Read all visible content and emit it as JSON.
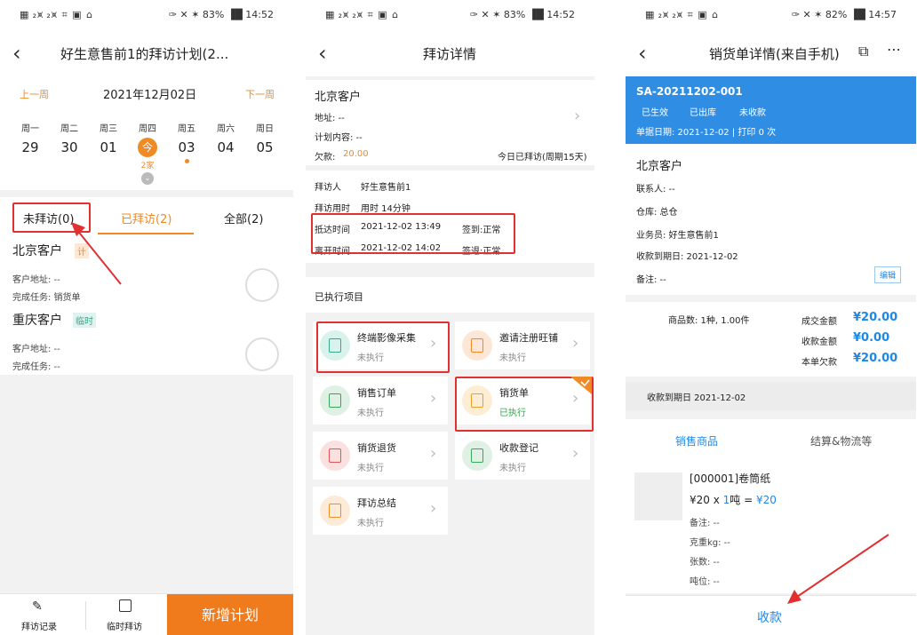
{
  "status": {
    "left_text": "▦ ₂⩙ ₂⩙ ⌗ ▣ ⌂",
    "right_text_1": "✑ ✕ ✶ 83% ▐█ 14:52",
    "right_text_2": "✑ ✕ ✶ 83% ▐█ 14:52",
    "right_text_3": "✑ ✕ ✶ 82% ▐█ 14:57"
  },
  "panel1": {
    "title": "好生意售前1的拜访计划(2...",
    "prev_week": "上一周",
    "date": "2021年12月02日",
    "next_week": "下一周",
    "week_days": [
      "周一",
      "周二",
      "周三",
      "周四",
      "周五",
      "周六",
      "周日"
    ],
    "week_dates": [
      "29",
      "30",
      "01",
      "今",
      "03",
      "04",
      "05"
    ],
    "today_count": "2家",
    "tabs": [
      "未拜访(0)",
      "已拜访(2)",
      "全部(2)"
    ],
    "clients": [
      {
        "name": "北京客户",
        "tag": "计",
        "address_label": "客户地址: --",
        "task_label": "完成任务: 销货单"
      },
      {
        "name": "重庆客户",
        "tag": "临时",
        "address_label": "客户地址: --",
        "task_label": "完成任务: --"
      }
    ],
    "bottom": {
      "record": "拜访记录",
      "temp": "临时拜访",
      "add": "新增计划"
    }
  },
  "panel2": {
    "title": "拜访详情",
    "client": "北京客户",
    "address": "地址: --",
    "plan": "计划内容: --",
    "debt_label": "欠款:",
    "debt_value": "20.00",
    "visited_today": "今日已拜访(周期15天)",
    "rows": [
      {
        "label": "拜访人",
        "value": "好生意售前1",
        "extra": ""
      },
      {
        "label": "拜访用时",
        "value": "用时 14分钟",
        "extra": ""
      },
      {
        "label": "抵达时间",
        "value": "2021-12-02 13:49",
        "extra": "签到:正常"
      },
      {
        "label": "离开时间",
        "value": "2021-12-02 14:02",
        "extra": "签退:正常"
      }
    ],
    "executed_title": "已执行项目",
    "items": [
      {
        "name": "终端影像采集",
        "status": "未执行"
      },
      {
        "name": "邀请注册旺铺",
        "status": "未执行"
      },
      {
        "name": "销售订单",
        "status": "未执行"
      },
      {
        "name": "销货单",
        "status": "已执行"
      },
      {
        "name": "销货退货",
        "status": "未执行"
      },
      {
        "name": "收款登记",
        "status": "未执行"
      },
      {
        "name": "拜访总结",
        "status": "未执行"
      }
    ]
  },
  "panel3": {
    "title": "销货单详情(来自手机)",
    "order_no": "SA-20211202-001",
    "badges": [
      "已生效",
      "已出库",
      "未收款"
    ],
    "order_date": "单据日期: 2021-12-02 | 打印 0 次",
    "client": "北京客户",
    "contact": "联系人: --",
    "warehouse": "仓库: 总仓",
    "salesman": "业务员: 好生意售前1",
    "due_date": "收款到期日: 2021-12-02",
    "remark": "备注: --",
    "edit": "编辑",
    "goods_count": "商品数: 1种, 1.00件",
    "amounts": [
      {
        "label": "成交金额",
        "value": "¥20.00"
      },
      {
        "label": "收款金额",
        "value": "¥0.00"
      },
      {
        "label": "本单欠款",
        "value": "¥20.00"
      }
    ],
    "due_bar": "收款到期日 2021-12-02",
    "tabs": [
      "销售商品",
      "结算&物流等"
    ],
    "product_name": "[000001]卷筒纸",
    "price_prefix": "¥20 x ",
    "price_qty": "1",
    "price_unit": "吨 = ",
    "price_total": "¥20",
    "product_fields": [
      "备注: --",
      "克重kg: --",
      "张数: --",
      "吨位: --"
    ],
    "collect": "收款"
  }
}
